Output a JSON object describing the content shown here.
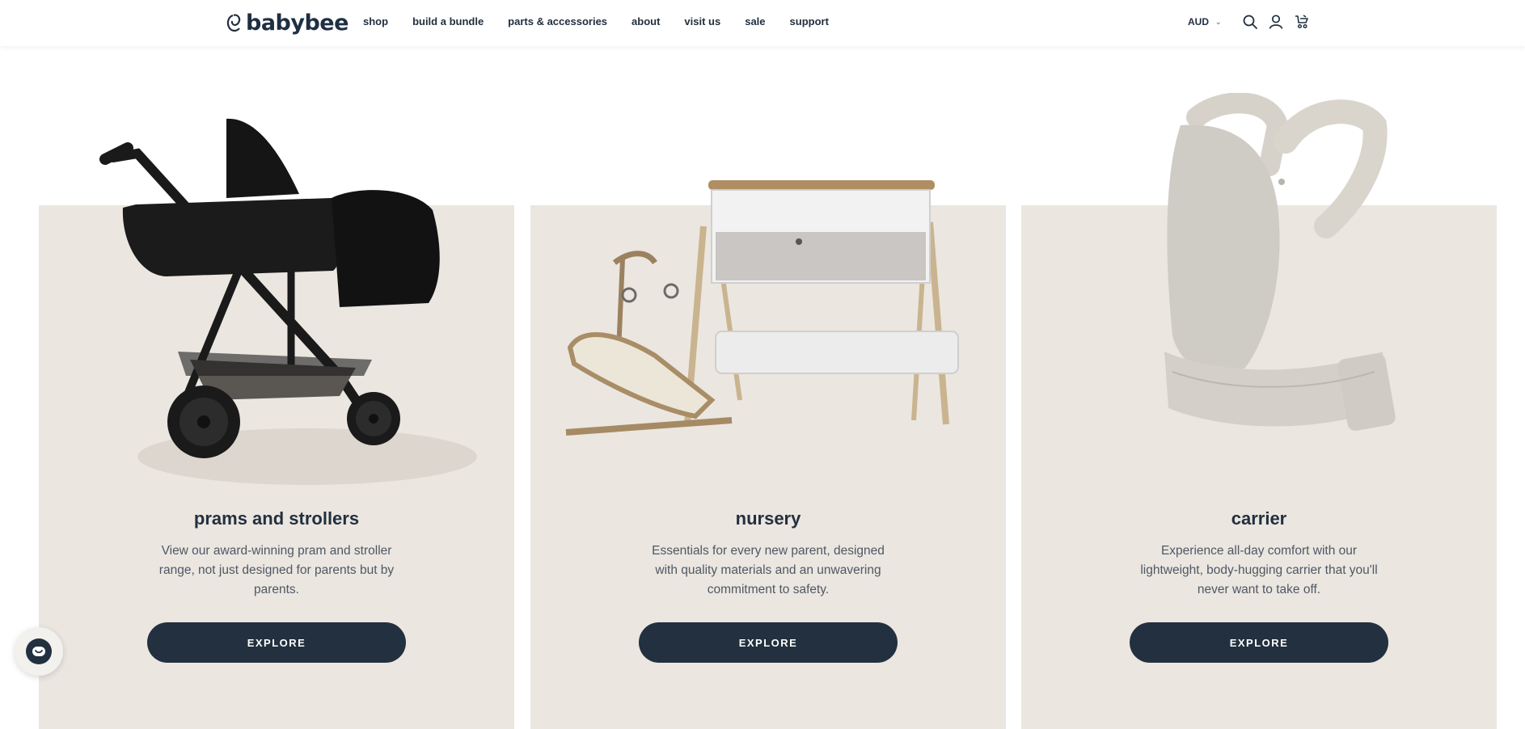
{
  "header": {
    "logo_text": "babybee",
    "nav": [
      "shop",
      "build a bundle",
      "parts & accessories",
      "about",
      "visit us",
      "sale",
      "support"
    ],
    "currency": "AUD",
    "icons": [
      "search-icon",
      "account-icon",
      "cart-icon"
    ]
  },
  "cards": [
    {
      "title": "prams and strollers",
      "description": "View our award-winning pram and stroller range, not just designed for parents but by parents.",
      "button": "EXPLORE",
      "image": "pram-image"
    },
    {
      "title": "nursery",
      "description": "Essentials for every new parent, designed with quality materials and an unwavering commitment to safety.",
      "button": "EXPLORE",
      "image": "bassinet-and-bouncer-image"
    },
    {
      "title": "carrier",
      "description": "Experience all-day comfort with our lightweight, body-hugging carrier that you'll never want to take off.",
      "button": "EXPLORE",
      "image": "baby-carrier-image"
    }
  ],
  "colors": {
    "card_background": "#ebe6e0",
    "button_background": "#22303f",
    "text_dark": "#22303f"
  },
  "chat_widget": {
    "icon": "chat-icon"
  }
}
